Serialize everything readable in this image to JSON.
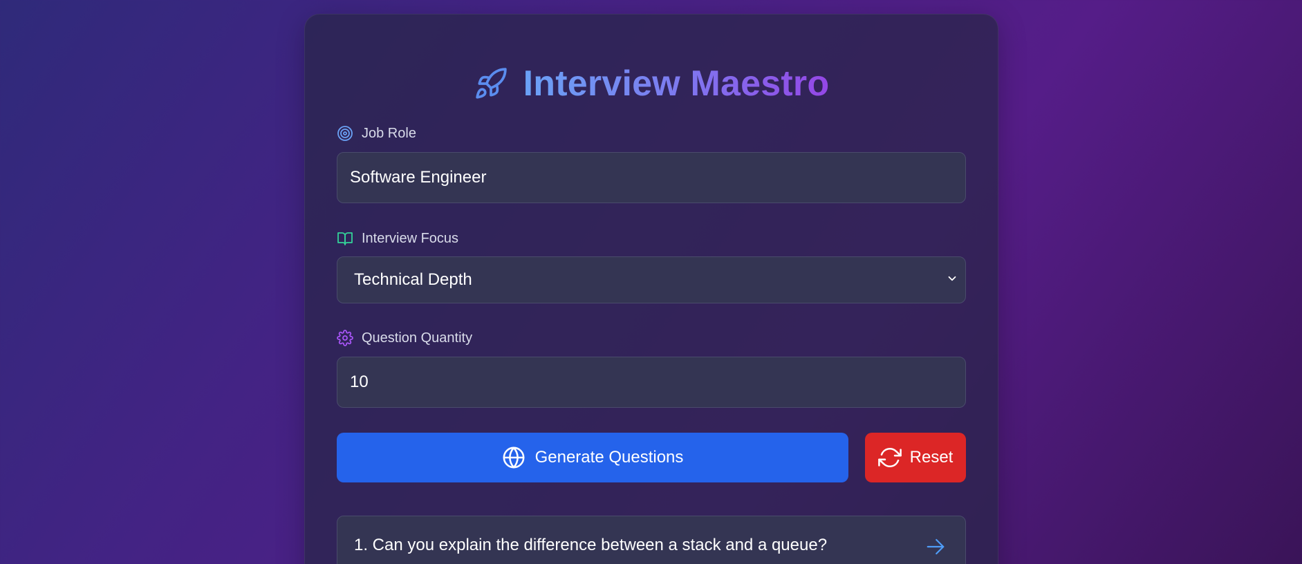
{
  "app": {
    "title": "Interview Maestro",
    "title_icon": "rocket-icon",
    "accent_gradient": [
      "#6aa2f6",
      "#9447e6"
    ]
  },
  "form": {
    "job_role": {
      "label": "Job Role",
      "icon": "target-icon",
      "value": "Software Engineer"
    },
    "interview_focus": {
      "label": "Interview Focus",
      "icon": "book-open-icon",
      "selected": "Technical Depth"
    },
    "question_quantity": {
      "label": "Question Quantity",
      "icon": "gear-icon",
      "value": "10"
    }
  },
  "actions": {
    "generate_label": "Generate Questions",
    "generate_icon": "globe-icon",
    "generate_color": "#2563eb",
    "reset_label": "Reset",
    "reset_icon": "refresh-icon",
    "reset_color": "#dc2626"
  },
  "questions": [
    {
      "text": "1. Can you explain the difference between a stack and a queue?",
      "icon": "arrow-right-icon"
    }
  ]
}
